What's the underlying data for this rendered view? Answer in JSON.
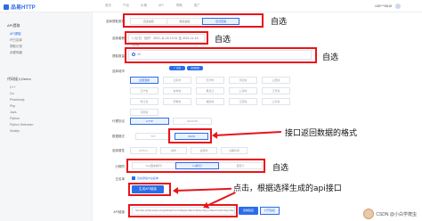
{
  "app": {
    "logo": "品易HTTP"
  },
  "header": {
    "nav": [
      "首页",
      "产品",
      "价格",
      "API",
      "帮助",
      "推广"
    ],
    "user_phone": "185****6818"
  },
  "sidebar": {
    "sections": [
      {
        "title": "API提取",
        "items": [
          "API提取",
          "IP白名单",
          "提取记录",
          "余额明细"
        ]
      },
      {
        "title": "代码接入Demo",
        "items": [
          "C++",
          "Go",
          "Phantomjs",
          "Php",
          "Java",
          "Python",
          "Python Selenium",
          "Nodejs"
        ]
      }
    ]
  },
  "form": {
    "rows": {
      "extract_type": {
        "label": "选择提取类型",
        "options": [
          "直连提取",
          "隧道提取",
          "包月套餐"
        ],
        "selected": 2
      },
      "package": {
        "label": "选择套餐",
        "value": "1 元/日 · 包时 · 2021-11-15 13:01 至 2021-11-16 13:01 ..."
      },
      "region": {
        "label": "提取数量",
        "value": "10"
      },
      "city": {
        "label": "选择城市",
        "tags": [
          "广东省",
          "全国混拨"
        ],
        "options": [
          "全国混拨",
          "北京市",
          "天津市",
          "河北省",
          "山西省",
          "辽宁省",
          "吉林省",
          "黑龙江",
          "上海市",
          "江苏省",
          "浙江省",
          "安徽省",
          "福建省",
          "江西省",
          "山东省",
          "河南省"
        ],
        "selected": 0
      },
      "protocol": {
        "label": "代理协议",
        "options": [
          "HTTP",
          "SOCKS5"
        ],
        "selected": 0
      },
      "data_format": {
        "label": "数据格式",
        "options": [
          "TXT",
          "JSON"
        ],
        "selected": 1
      },
      "options": {
        "label": "选择属性",
        "options": [
          "IP:Port",
          "城市",
          "运营商",
          "过期时间"
        ],
        "selected": 0
      },
      "separator": {
        "label": "分隔符",
        "options": [
          "\\r\\n(回车换行)",
          "\\n(换行)",
          "自定义"
        ],
        "selected": 1
      },
      "whitelist": {
        "label": "白名单",
        "checkbox": "自动添加IP白名单"
      },
      "generate": {
        "label": "生成API链接"
      },
      "api_link": {
        "label": "API链接",
        "value": "http://tiqu.pyhttp.taolop.com/getflowip?num=10&type=2&pro=0&city=0&yys=0&port=1&ts=0&ys=0&cs=0&lb=1&sb=0&pb=4&mr=1&regions=",
        "copy_label": "复制链接",
        "open_label": "打开链接"
      }
    }
  },
  "annotations": {
    "zixuan_1": "自选",
    "zixuan_2": "自选",
    "zixuan_3": "自选",
    "format": "接口返回数据的格式",
    "zixuan_4": "自选",
    "click": "点击，根据选择生成的api接口"
  },
  "watermark": "CSDN @小白学爬虫",
  "colors": {
    "accent": "#2b6de8",
    "annotation": "#e8141b"
  }
}
